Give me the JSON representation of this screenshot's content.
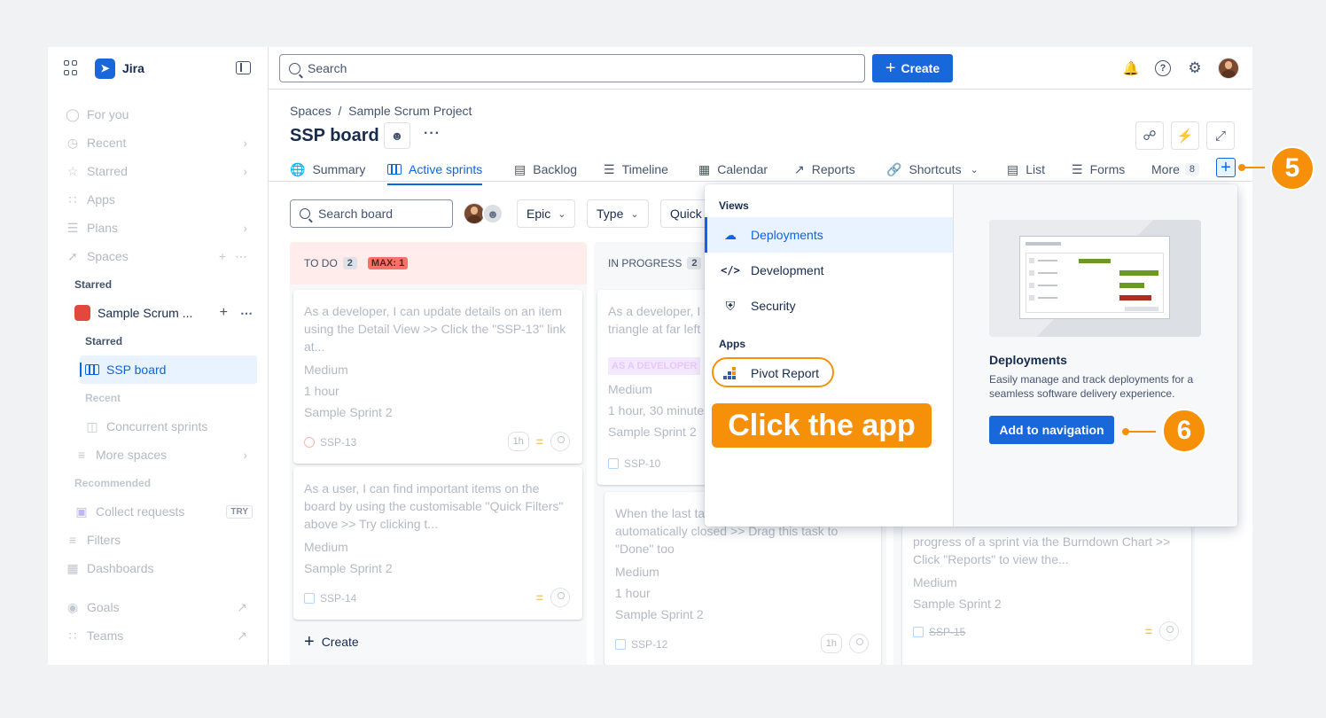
{
  "sidebar": {
    "app_name": "Jira",
    "items": {
      "for_you": "For you",
      "recent": "Recent",
      "starred": "Starred",
      "apps": "Apps",
      "plans": "Plans",
      "spaces": "Spaces"
    },
    "starred_section": "Starred",
    "project_name": "Sample Scrum ...",
    "starred_sub": "Starred",
    "active_board": "SSP board",
    "recent_sub": "Recent",
    "concurrent": "Concurrent sprints",
    "more_spaces": "More spaces",
    "recommended": "Recommended",
    "collect_requests": "Collect requests",
    "try_badge": "TRY",
    "filters": "Filters",
    "dashboards": "Dashboards",
    "goals": "Goals",
    "teams": "Teams"
  },
  "topbar": {
    "search_placeholder": "Search",
    "create_label": "Create"
  },
  "page": {
    "breadcrumb": "Spaces  /  Sample Scrum Project",
    "title": "SSP board"
  },
  "tabs": {
    "summary": "Summary",
    "active_sprints": "Active sprints",
    "backlog": "Backlog",
    "timeline": "Timeline",
    "calendar": "Calendar",
    "reports": "Reports",
    "shortcuts": "Shortcuts",
    "list": "List",
    "forms": "Forms",
    "more": "More",
    "more_count": "8"
  },
  "board": {
    "search_placeholder": "Search board",
    "filters": [
      "Epic",
      "Type",
      "Quick"
    ],
    "columns": [
      {
        "name": "TO DO",
        "count": "2",
        "max": "MAX: 1",
        "create": "Create"
      },
      {
        "name": "IN PROGRESS",
        "count": "2"
      }
    ],
    "todo_cards": [
      {
        "summary": "As a developer, I can update details on an item using the Detail View >> Click the \"SSP-13\" link at...",
        "priority": "Medium",
        "estimate": "1 hour",
        "sprint": "Sample Sprint 2",
        "key": "SSP-13",
        "est_badge": "1h"
      },
      {
        "summary": "As a user, I can find important items on the board by using the customisable \"Quick Filters\" above >> Try clicking t...",
        "priority": "Medium",
        "sprint": "Sample Sprint 2",
        "key": "SSP-14"
      }
    ],
    "inprogress_cards": [
      {
        "summary": "As a developer, I can update task status with triangle at far left",
        "label": "AS A DEVELOPER",
        "priority": "Medium",
        "estimate": "1 hour, 30 minutes",
        "sprint": "Sample Sprint 2",
        "key": "SSP-10"
      },
      {
        "summary": "When the last task is done, the story can be automatically closed >> Drag this task to \"Done\" too",
        "priority": "Medium",
        "estimate": "1 hour",
        "sprint": "Sample Sprint 2",
        "key": "SSP-12",
        "est_badge": "1h"
      }
    ],
    "done_card": {
      "summary": "progress of a sprint via the Burndown Chart >> Click \"Reports\" to view the...",
      "priority": "Medium",
      "sprint": "Sample Sprint 2",
      "key": "SSP-15"
    }
  },
  "dropdown": {
    "views_heading": "Views",
    "views": [
      "Deployments",
      "Development",
      "Security"
    ],
    "apps_heading": "Apps",
    "apps": [
      "Pivot Report"
    ],
    "callout": "Click the app",
    "detail_title": "Deployments",
    "detail_desc": "Easily manage and track deployments for a seamless software delivery experience.",
    "add_button": "Add to navigation"
  },
  "steps": {
    "step5": "5",
    "step6": "6"
  },
  "colors": {
    "accent": "#1868db",
    "highlight": "#f79009",
    "selected_bg": "#e9f2ff"
  }
}
